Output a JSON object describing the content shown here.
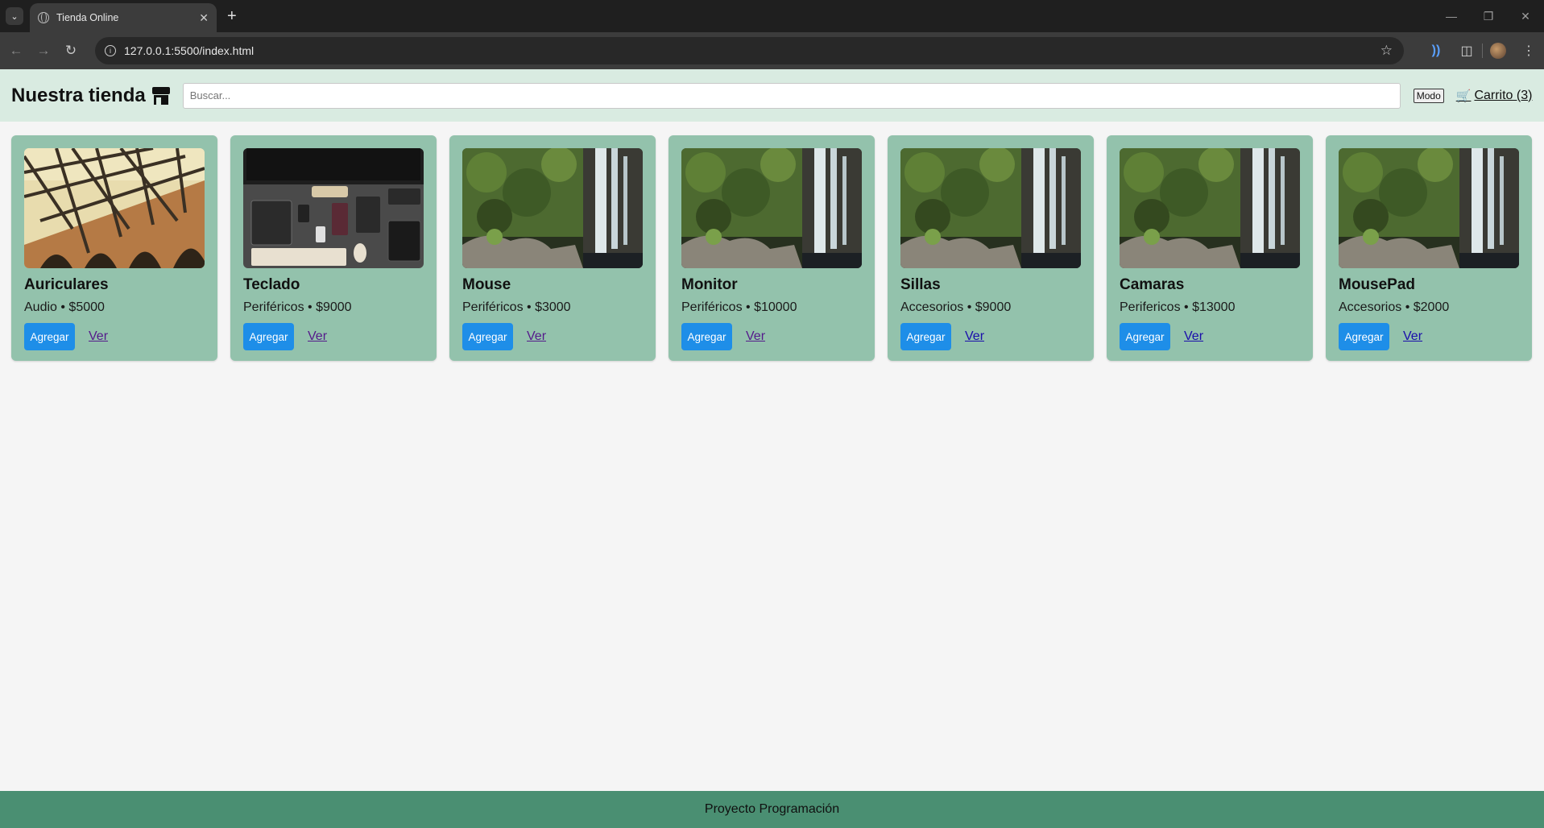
{
  "browser": {
    "tab_title": "Tienda Online",
    "url": "127.0.0.1:5500/index.html"
  },
  "header": {
    "title": "Nuestra tienda",
    "search_placeholder": "Buscar...",
    "mode_label": "Modo",
    "cart_label": "Carrito (3)"
  },
  "products": [
    {
      "name": "Auriculares",
      "meta": "Audio • $5000",
      "add_label": "Agregar",
      "view_label": "Ver",
      "image": "bridge"
    },
    {
      "name": "Teclado",
      "meta": "Periféricos • $9000",
      "add_label": "Agregar",
      "view_label": "Ver",
      "image": "desk"
    },
    {
      "name": "Mouse",
      "meta": "Periféricos • $3000",
      "add_label": "Agregar",
      "view_label": "Ver",
      "image": "waterfall"
    },
    {
      "name": "Monitor",
      "meta": "Periféricos • $10000",
      "add_label": "Agregar",
      "view_label": "Ver",
      "image": "waterfall"
    },
    {
      "name": "Sillas",
      "meta": "Accesorios • $9000",
      "add_label": "Agregar",
      "view_label": "Ver",
      "image": "waterfall"
    },
    {
      "name": "Camaras",
      "meta": "Perifericos • $13000",
      "add_label": "Agregar",
      "view_label": "Ver",
      "image": "waterfall"
    },
    {
      "name": "MousePad",
      "meta": "Accesorios • $2000",
      "add_label": "Agregar",
      "view_label": "Ver",
      "image": "waterfall"
    }
  ],
  "footer": {
    "text": "Proyecto Programación"
  },
  "colors": {
    "header_bg": "#d9ebe1",
    "card_bg": "#93c2ac",
    "button_bg": "#1e8ee8",
    "footer_bg": "#4a8f72"
  }
}
